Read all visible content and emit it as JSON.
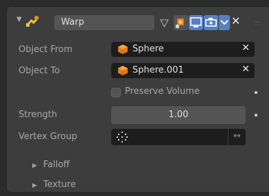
{
  "header": {
    "name_value": "Warp",
    "close_glyph": "✕",
    "icons": [
      "collapse-arrow-icon",
      "warp-modifier-icon",
      "vertex-filter-icon",
      "camera-icon",
      "monitor-icon",
      "editmode-icon",
      "dropdown-chevron-icon",
      "close-icon",
      "drag-grip-icon"
    ]
  },
  "rows": {
    "object_from": {
      "label": "Object From",
      "value": "Sphere",
      "clear": "✕"
    },
    "object_to": {
      "label": "Object To",
      "value": "Sphere.001",
      "clear": "✕"
    },
    "preserve_volume": {
      "label": "Preserve Volume",
      "checked": false
    },
    "strength": {
      "label": "Strength",
      "value": "1.00"
    },
    "vertex_group": {
      "label": "Vertex Group",
      "value": "",
      "swap_glyph": "↔"
    }
  },
  "subpanels": [
    {
      "label": "Falloff"
    },
    {
      "label": "Texture"
    }
  ],
  "colors": {
    "panel_bg": "#3d3d3d",
    "field_dark": "#1d1d1d",
    "field_mid": "#545454",
    "active_blue": "#5680c2",
    "orange": "#e07b1e"
  }
}
